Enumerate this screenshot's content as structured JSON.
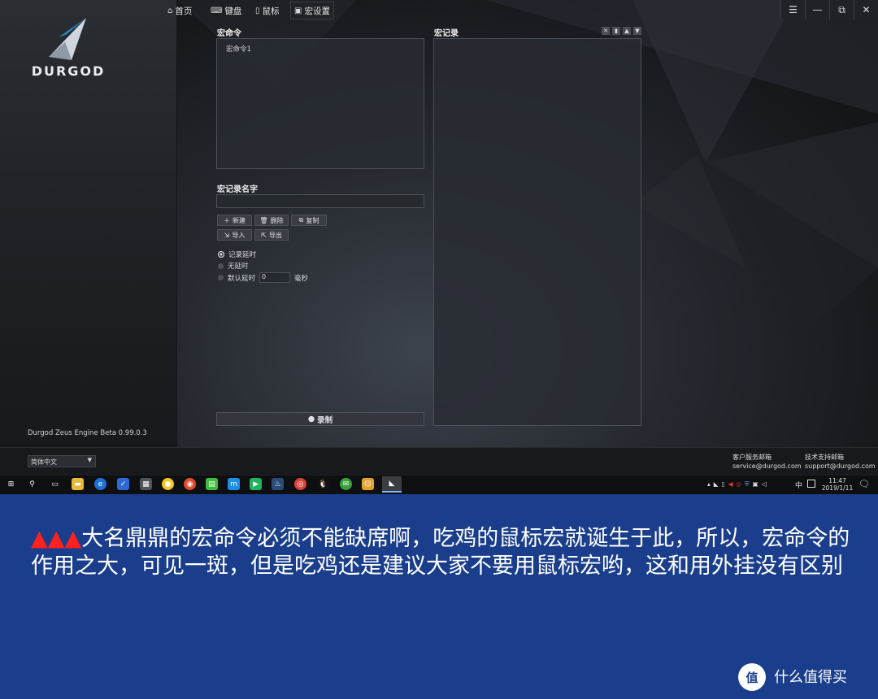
{
  "brand": {
    "name": "DURGOD",
    "version": "Durgod Zeus Engine Beta 0.99.0.3"
  },
  "nav": [
    {
      "label": "首页",
      "icon": "home-icon"
    },
    {
      "label": "键盘",
      "icon": "keyboard-icon"
    },
    {
      "label": "鼠标",
      "icon": "mouse-icon"
    },
    {
      "label": "宏设置",
      "icon": "macro-icon"
    }
  ],
  "nav_active": "宏设置",
  "window_controls": [
    "menu-icon",
    "minimize-icon",
    "restore-icon",
    "close-icon"
  ],
  "macro": {
    "title": "宏命令",
    "items": [
      "宏命令1"
    ],
    "name_title": "宏记录名字",
    "name_value": "",
    "buttons": {
      "new": "新建",
      "delete": "删除",
      "copy": "复制",
      "import": "导入",
      "export": "导出"
    },
    "options": {
      "record_delay": "记录延时",
      "no_delay": "无延时",
      "default_delay": "默认延时",
      "default_delay_value": "0",
      "unit": "毫秒"
    },
    "selected_option": "record_delay",
    "record_button": "录制"
  },
  "record": {
    "title": "宏记录"
  },
  "footer": {
    "language": "简体中文",
    "customer_label": "客户服务邮箱",
    "customer_email": "service@durgod.com",
    "tech_label": "技术支持邮箱",
    "tech_email": "support@durgod.com"
  },
  "taskbar": {
    "time": "11:47",
    "date": "2019/1/11",
    "ime": "中"
  },
  "caption": {
    "triangles": "▲▲▲",
    "text": "大名鼎鼎的宏命令必须不能缺席啊，吃鸡的鼠标宏就诞生于此，所以，宏命令的作用之大，可见一斑，但是吃鸡还是建议大家不要用鼠标宏哟，这和用外挂没有区别"
  },
  "watermark": {
    "logo": "值",
    "text": "什么值得买"
  }
}
